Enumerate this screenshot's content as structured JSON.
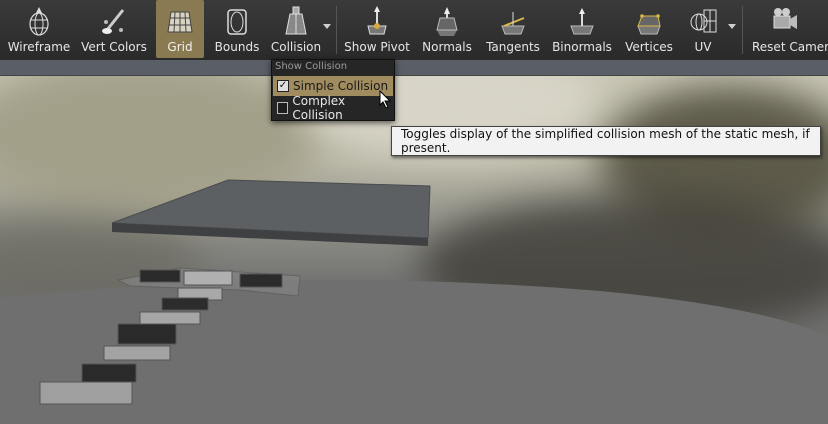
{
  "toolbar": {
    "buttons": [
      {
        "id": "wireframe",
        "label": "Wireframe",
        "icon": "wireframe-sphere-icon"
      },
      {
        "id": "vert-colors",
        "label": "Vert Colors",
        "icon": "paint-brush-icon"
      },
      {
        "id": "grid",
        "label": "Grid",
        "icon": "grid-icon",
        "active": true
      },
      {
        "id": "bounds",
        "label": "Bounds",
        "icon": "bounds-box-icon"
      },
      {
        "id": "collision",
        "label": "Collision",
        "icon": "collision-icon",
        "dropdown": true
      },
      {
        "id": "show-pivot",
        "label": "Show Pivot",
        "icon": "pivot-icon"
      },
      {
        "id": "normals",
        "label": "Normals",
        "icon": "normals-icon"
      },
      {
        "id": "tangents",
        "label": "Tangents",
        "icon": "tangents-icon"
      },
      {
        "id": "binormals",
        "label": "Binormals",
        "icon": "binormals-icon"
      },
      {
        "id": "vertices",
        "label": "Vertices",
        "icon": "vertices-icon"
      },
      {
        "id": "uv",
        "label": "UV",
        "icon": "uv-icon",
        "dropdown": true
      },
      {
        "id": "reset-camera",
        "label": "Reset Camera",
        "icon": "camera-icon"
      }
    ]
  },
  "collision_menu": {
    "header": "Show Collision",
    "items": [
      {
        "label": "Simple Collision",
        "checked": true,
        "highlighted": true
      },
      {
        "label": "Complex Collision",
        "checked": false,
        "highlighted": false
      }
    ]
  },
  "tooltip": {
    "text": "Toggles display of the simplified collision mesh of the static mesh, if present."
  },
  "colors": {
    "active_button": "#8a7a52",
    "menu_highlight": "#a08c5e",
    "toolbar_bg": "#2e2e2e"
  }
}
